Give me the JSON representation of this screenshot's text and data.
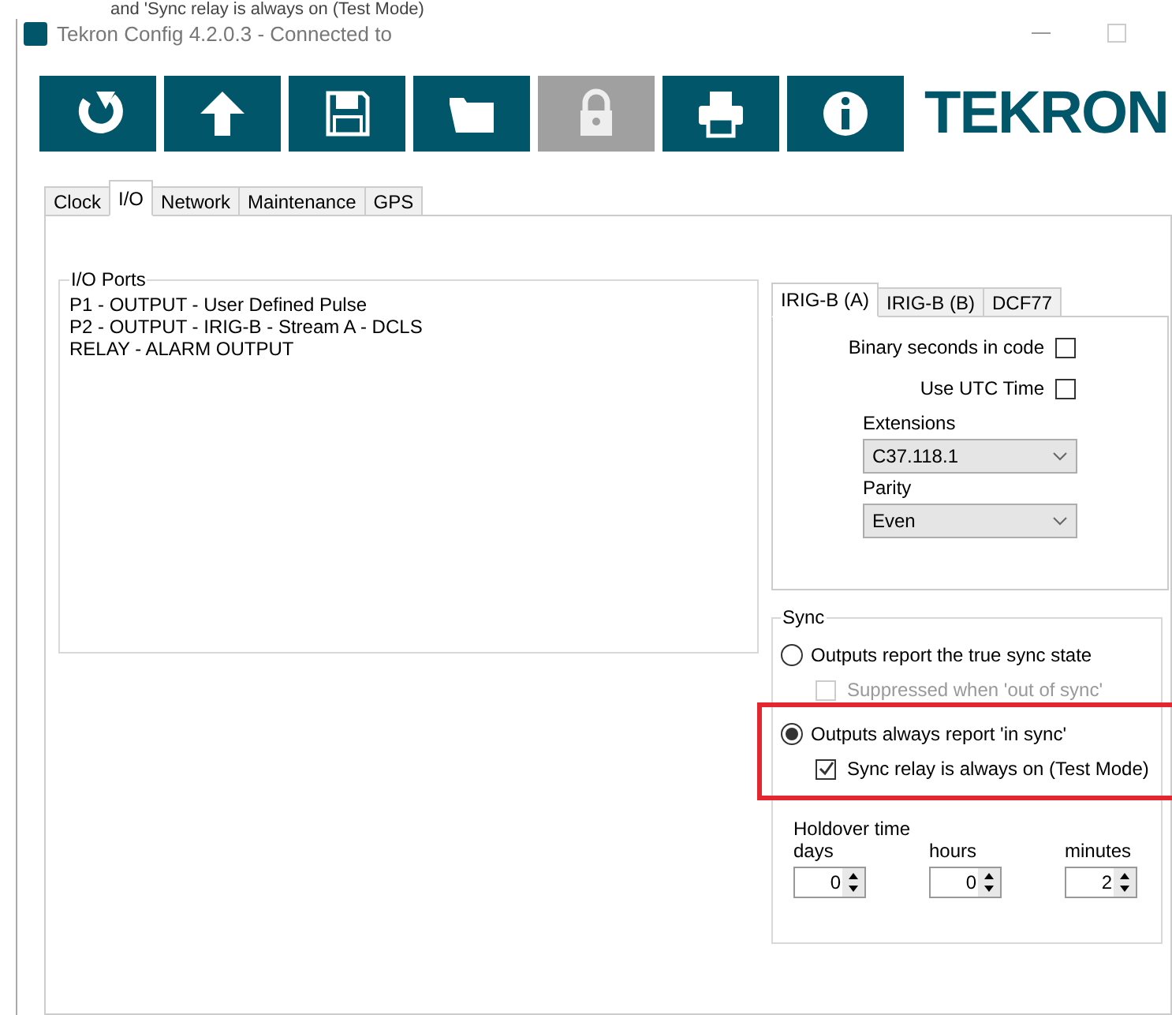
{
  "caption": "and 'Sync relay is always on (Test Mode)",
  "window": {
    "title": "Tekron Config 4.2.0.3 - Connected to"
  },
  "toolbar": [
    {
      "kind": "refresh",
      "disabled": false
    },
    {
      "kind": "upload",
      "disabled": false
    },
    {
      "kind": "save",
      "disabled": false
    },
    {
      "kind": "open",
      "disabled": false
    },
    {
      "kind": "lock",
      "disabled": true
    },
    {
      "kind": "print",
      "disabled": false
    },
    {
      "kind": "info",
      "disabled": false
    }
  ],
  "logo": "TEKRON",
  "tabs": [
    {
      "label": "Clock",
      "selected": false
    },
    {
      "label": "I/O",
      "selected": true
    },
    {
      "label": "Network",
      "selected": false
    },
    {
      "label": "Maintenance",
      "selected": false
    },
    {
      "label": "GPS",
      "selected": false
    }
  ],
  "io_ports": {
    "title": "I/O Ports",
    "lines": [
      "P1 - OUTPUT - User Defined Pulse",
      "P2 - OUTPUT - IRIG-B - Stream A - DCLS",
      "RELAY - ALARM OUTPUT"
    ]
  },
  "signal_tabs": [
    {
      "label": "IRIG-B (A)",
      "selected": true
    },
    {
      "label": "IRIG-B (B)",
      "selected": false
    },
    {
      "label": "DCF77",
      "selected": false
    }
  ],
  "checks": [
    {
      "label": "Binary seconds in code",
      "checked": false
    },
    {
      "label": "Use UTC Time",
      "checked": false
    }
  ],
  "dropdowns": [
    {
      "label": "Extensions",
      "value": "C37.118.1"
    },
    {
      "label": "Parity",
      "value": "Even"
    }
  ],
  "sync": {
    "title": "Sync",
    "options": [
      {
        "label": "Outputs report the true sync state",
        "selected": false,
        "highlighted": false,
        "sub": {
          "label": "Suppressed when 'out of sync'",
          "checked": false,
          "disabled": true
        }
      },
      {
        "label": "Outputs always report 'in sync'",
        "selected": true,
        "highlighted": true,
        "sub": {
          "label": "Sync relay is always on (Test Mode)",
          "checked": true,
          "disabled": false
        }
      }
    ]
  },
  "holdover": {
    "title": "Holdover time",
    "fields": [
      {
        "label": "days",
        "value": "0"
      },
      {
        "label": "hours",
        "value": "0"
      },
      {
        "label": "minutes",
        "value": "2"
      }
    ]
  }
}
